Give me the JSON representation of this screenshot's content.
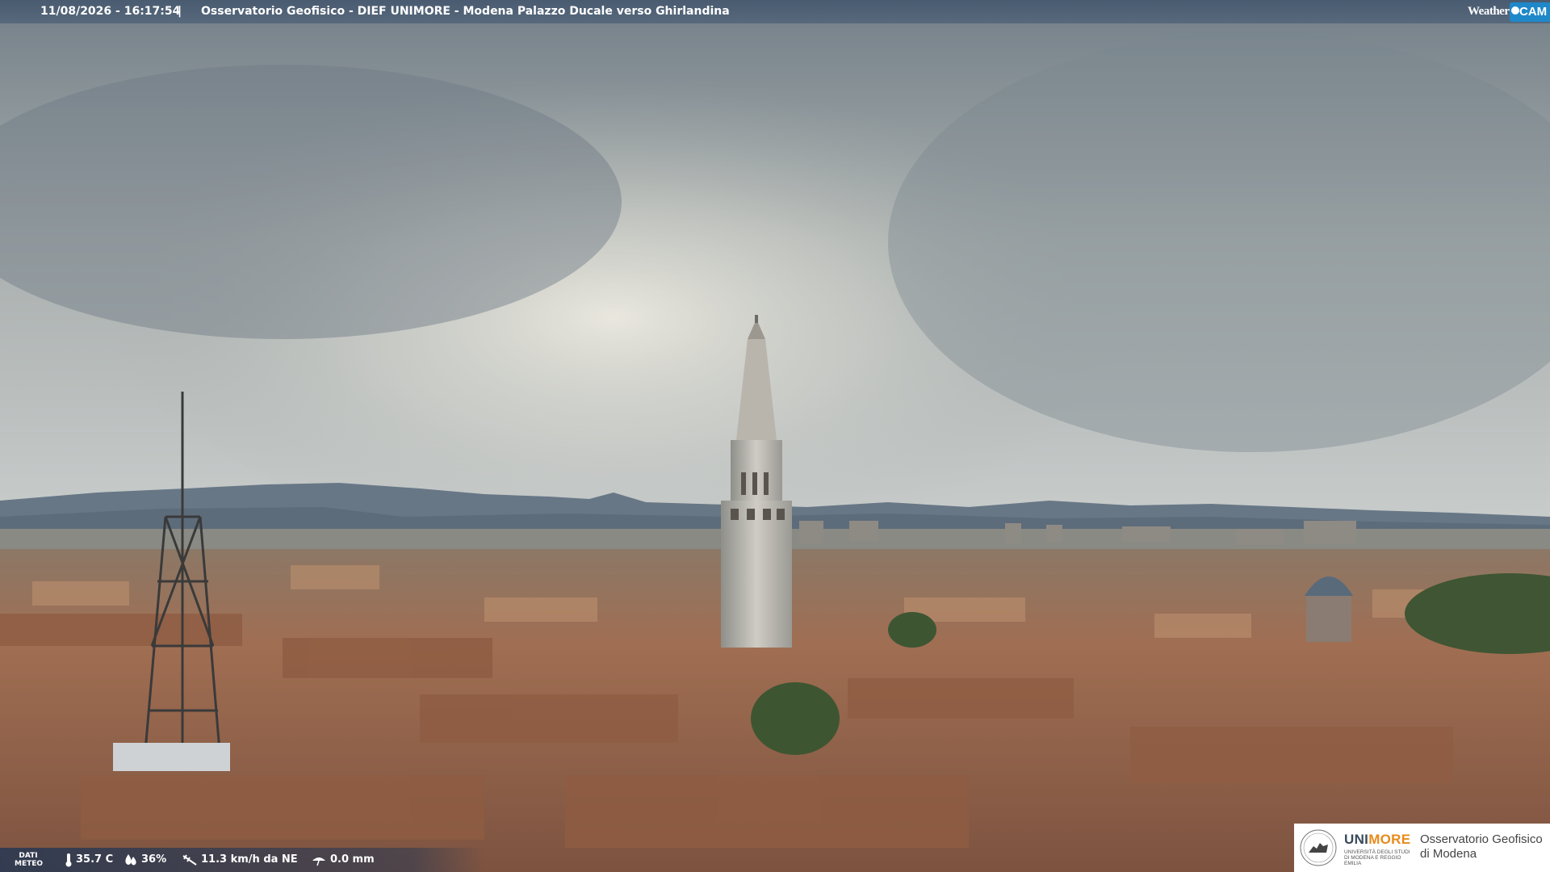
{
  "top_bar": {
    "timestamp": "11/08/2026 - 16:17:54",
    "separator": "|",
    "title": "Osservatorio Geofisico - DIEF UNIMORE - Modena Palazzo Ducale verso Ghirlandina"
  },
  "weathercam_logo": {
    "word": "Weather",
    "cam": "CAM",
    "accent": "#1f88c9"
  },
  "meteo": {
    "label_line1": "DATI",
    "label_line2": "METEO",
    "temperature": "35.7 C",
    "humidity": "36%",
    "wind": "11.3 km/h da NE",
    "rain": "0.0 mm",
    "icons": [
      "thermometer-icon",
      "humidity-drop-icon",
      "wind-icon",
      "rain-icon"
    ]
  },
  "institution_logo": {
    "uni": "UNI",
    "more": "MORE",
    "subtitle": "UNIVERSITÀ DEGLI STUDI DI MODENA E REGGIO EMILIA",
    "obs_line1": "Osservatorio Geofisico",
    "obs_line2": "di Modena"
  },
  "colors": {
    "sky_top": "#7e8a93",
    "sky_bright": "#dcdcd6",
    "roof": "#9b6a4f",
    "mountains": "#5b6a78"
  }
}
